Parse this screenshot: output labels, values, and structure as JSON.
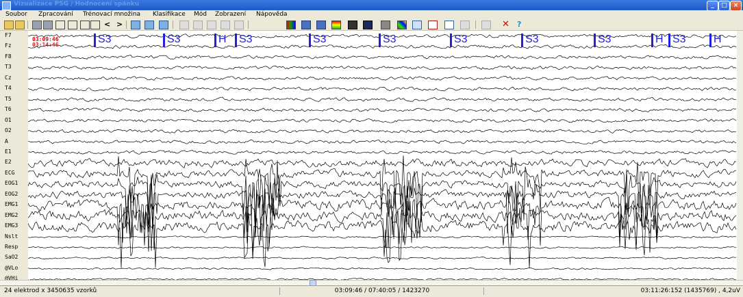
{
  "window": {
    "title": "Vizualizace PSG / Hodnocení spánku"
  },
  "menu": [
    "Soubor",
    "Zpracování",
    "Trénovací množina",
    "Klasifikace",
    "Mód",
    "Zobrazení",
    "Nápověda"
  ],
  "channels": [
    "F7",
    "Fz",
    "F8",
    "T3",
    "Cz",
    "T4",
    "T5",
    "T6",
    "O1",
    "O2",
    "A",
    "E1",
    "E2",
    "ECG",
    "EOG1",
    "EOG2",
    "EMG1",
    "EMG2",
    "EMG3",
    "Nslt",
    "Resp",
    "SaO2",
    "@VLo",
    "@VHi"
  ],
  "time_labels": {
    "current": "03:09:46",
    "previous": "03:14:46"
  },
  "stage_markers": [
    "S3",
    "S3",
    "H",
    "S3",
    "S3",
    "S3",
    "S3",
    "S3",
    "S3",
    "H",
    "S3",
    "H"
  ],
  "colors": {
    "signal": "#000000",
    "stage": "#2020e0",
    "time": "#e00000"
  },
  "status": {
    "left": "24 elektrod x 3450635 vzorků",
    "middle": "03:09:46 / 07:40:05 / 1423270",
    "right": "03:11:26:152 (1435769) , 4,2uV"
  }
}
